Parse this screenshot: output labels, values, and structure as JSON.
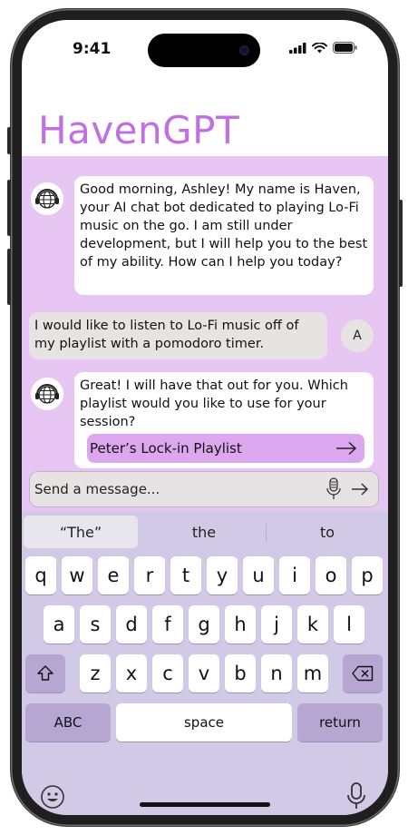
{
  "status_bar": {
    "time": "9:41"
  },
  "app": {
    "title": "HavenGPT"
  },
  "messages": [
    {
      "sender": "bot",
      "text": "Good morning, Ashley! My name is Haven, your AI chat bot dedicated to playing Lo-Fi music on the go. I am still under development, but I will help you to the best of my ability. How can I help you today?"
    },
    {
      "sender": "user",
      "avatar_initial": "A",
      "text": "I would like to listen to Lo-Fi music off of my playlist with a pomodoro timer."
    },
    {
      "sender": "bot",
      "text": "Great! I will have that out for you. Which playlist would you like to use for your session?",
      "action_label": "Peter’s Lock-in Playlist"
    }
  ],
  "composer": {
    "placeholder": "Send a message..."
  },
  "keyboard": {
    "suggestions": [
      "“The”",
      "the",
      "to"
    ],
    "row1": [
      "q",
      "w",
      "e",
      "r",
      "t",
      "y",
      "u",
      "i",
      "o",
      "p"
    ],
    "row2": [
      "a",
      "s",
      "d",
      "f",
      "g",
      "h",
      "j",
      "k",
      "l"
    ],
    "row3": [
      "z",
      "x",
      "c",
      "v",
      "b",
      "n",
      "m"
    ],
    "abc_label": "ABC",
    "space_label": "space",
    "return_label": "return"
  },
  "colors": {
    "accent": "#c070e0",
    "chat_bg": "#e8c6f3",
    "keyboard_bg": "#d1c9e6",
    "action_bg": "#dda7ef"
  }
}
